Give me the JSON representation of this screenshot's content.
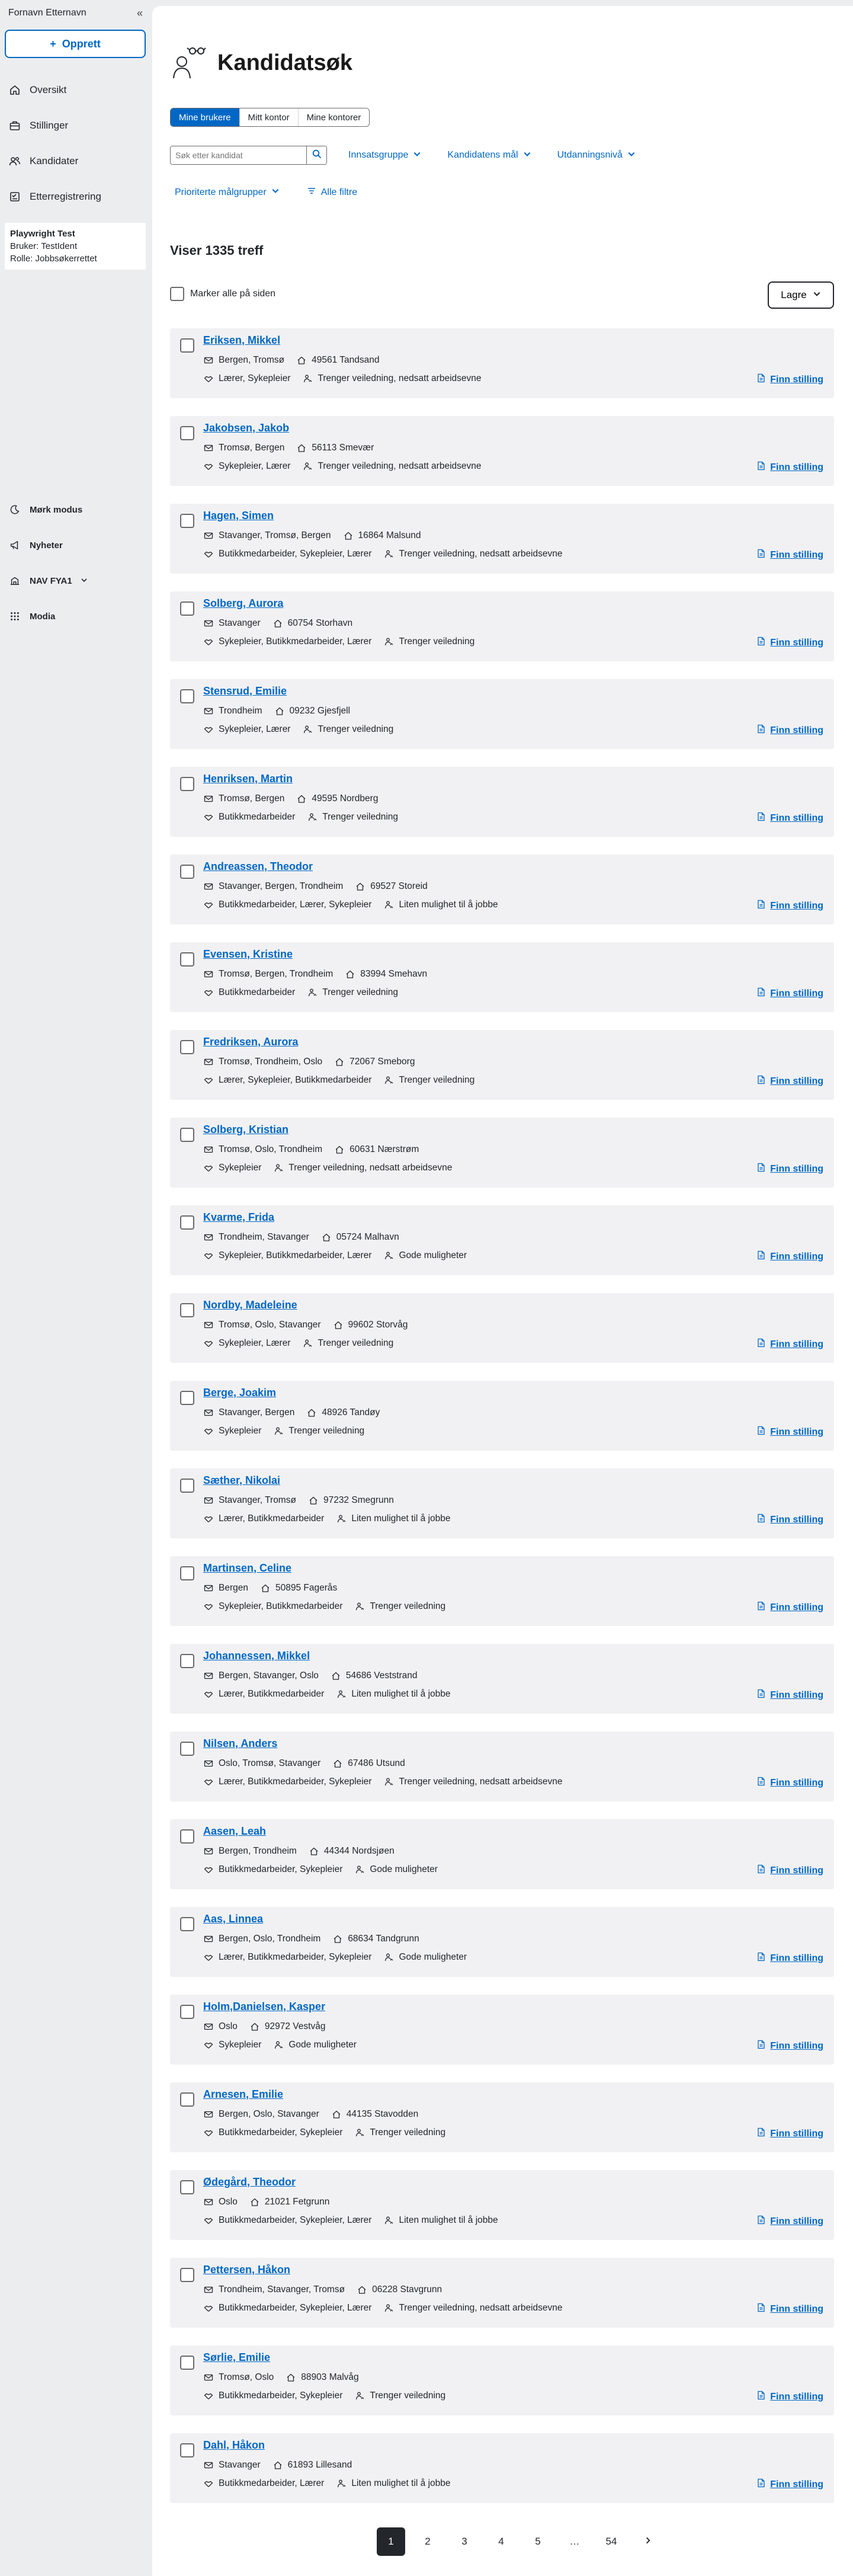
{
  "sidebar": {
    "user_name": "Fornavn Etternavn",
    "collapse_icon": "«",
    "create_button": "Opprett",
    "nav": [
      {
        "label": "Oversikt",
        "icon": "home-icon"
      },
      {
        "label": "Stillinger",
        "icon": "briefcase-icon"
      },
      {
        "label": "Kandidater",
        "icon": "people-icon"
      },
      {
        "label": "Etterregistrering",
        "icon": "checklist-icon"
      }
    ],
    "info": {
      "title": "Playwright Test",
      "user": "Bruker: TestIdent",
      "role": "Rolle: Jobbsøkerrettet"
    },
    "bottom": [
      {
        "label": "Mørk modus",
        "icon": "moon-icon"
      },
      {
        "label": "Nyheter",
        "icon": "megaphone-icon"
      },
      {
        "label": "NAV FYA1",
        "icon": "office-icon"
      },
      {
        "label": "Modia",
        "icon": "grid-icon"
      }
    ]
  },
  "header": {
    "title": "Kandidatsøk"
  },
  "tabs": [
    "Mine brukere",
    "Mitt kontor",
    "Mine kontorer"
  ],
  "active_tab": 0,
  "search": {
    "placeholder": "Søk etter kandidat",
    "value": ""
  },
  "filters": [
    "Innsatsgruppe",
    "Kandidatens mål",
    "Utdanningsnivå"
  ],
  "filters2": {
    "priority": "Prioriterte målgrupper",
    "all": "Alle filtre"
  },
  "result_count": "Viser 1335 treff",
  "select_all_label": "Marker alle på siden",
  "save_button": "Lagre",
  "finn_stilling_label": "Finn stilling",
  "candidates": [
    {
      "name": "Eriksen, Mikkel",
      "locations": "Bergen, Tromsø",
      "address": "49561 Tandsand",
      "jobs": "Lærer, Sykepleier",
      "need": "Trenger veiledning, nedsatt arbeidsevne"
    },
    {
      "name": "Jakobsen, Jakob",
      "locations": "Tromsø, Bergen",
      "address": "56113 Smevær",
      "jobs": "Sykepleier, Lærer",
      "need": "Trenger veiledning, nedsatt arbeidsevne"
    },
    {
      "name": "Hagen, Simen",
      "locations": "Stavanger, Tromsø, Bergen",
      "address": "16864 Malsund",
      "jobs": "Butikkmedarbeider, Sykepleier, Lærer",
      "need": "Trenger veiledning, nedsatt arbeidsevne"
    },
    {
      "name": "Solberg, Aurora",
      "locations": "Stavanger",
      "address": "60754 Storhavn",
      "jobs": "Sykepleier, Butikkmedarbeider, Lærer",
      "need": "Trenger veiledning"
    },
    {
      "name": "Stensrud, Emilie",
      "locations": "Trondheim",
      "address": "09232 Gjesfjell",
      "jobs": "Sykepleier, Lærer",
      "need": "Trenger veiledning"
    },
    {
      "name": "Henriksen, Martin",
      "locations": "Tromsø, Bergen",
      "address": "49595 Nordberg",
      "jobs": "Butikkmedarbeider",
      "need": "Trenger veiledning"
    },
    {
      "name": "Andreassen, Theodor",
      "locations": "Stavanger, Bergen, Trondheim",
      "address": "69527 Storeid",
      "jobs": "Butikkmedarbeider, Lærer, Sykepleier",
      "need": "Liten mulighet til å jobbe"
    },
    {
      "name": "Evensen, Kristine",
      "locations": "Tromsø, Bergen, Trondheim",
      "address": "83994 Smehavn",
      "jobs": "Butikkmedarbeider",
      "need": "Trenger veiledning"
    },
    {
      "name": "Fredriksen, Aurora",
      "locations": "Tromsø, Trondheim, Oslo",
      "address": "72067 Smeborg",
      "jobs": "Lærer, Sykepleier, Butikkmedarbeider",
      "need": "Trenger veiledning"
    },
    {
      "name": "Solberg, Kristian",
      "locations": "Tromsø, Oslo, Trondheim",
      "address": "60631 Nærstrøm",
      "jobs": "Sykepleier",
      "need": "Trenger veiledning, nedsatt arbeidsevne"
    },
    {
      "name": "Kvarme, Frida",
      "locations": "Trondheim, Stavanger",
      "address": "05724 Malhavn",
      "jobs": "Sykepleier, Butikkmedarbeider, Lærer",
      "need": "Gode muligheter"
    },
    {
      "name": "Nordby, Madeleine",
      "locations": "Tromsø, Oslo, Stavanger",
      "address": "99602 Storvåg",
      "jobs": "Sykepleier, Lærer",
      "need": "Trenger veiledning"
    },
    {
      "name": "Berge, Joakim",
      "locations": "Stavanger, Bergen",
      "address": "48926 Tandøy",
      "jobs": "Sykepleier",
      "need": "Trenger veiledning"
    },
    {
      "name": "Sæther, Nikolai",
      "locations": "Stavanger, Tromsø",
      "address": "97232 Smegrunn",
      "jobs": "Lærer, Butikkmedarbeider",
      "need": "Liten mulighet til å jobbe"
    },
    {
      "name": "Martinsen, Celine",
      "locations": "Bergen",
      "address": "50895 Fagerås",
      "jobs": "Sykepleier, Butikkmedarbeider",
      "need": "Trenger veiledning"
    },
    {
      "name": "Johannessen, Mikkel",
      "locations": "Bergen, Stavanger, Oslo",
      "address": "54686 Veststrand",
      "jobs": "Lærer, Butikkmedarbeider",
      "need": "Liten mulighet til å jobbe"
    },
    {
      "name": "Nilsen, Anders",
      "locations": "Oslo, Tromsø, Stavanger",
      "address": "67486 Utsund",
      "jobs": "Lærer, Butikkmedarbeider, Sykepleier",
      "need": "Trenger veiledning, nedsatt arbeidsevne"
    },
    {
      "name": "Aasen, Leah",
      "locations": "Bergen, Trondheim",
      "address": "44344 Nordsjøen",
      "jobs": "Butikkmedarbeider, Sykepleier",
      "need": "Gode muligheter"
    },
    {
      "name": "Aas, Linnea",
      "locations": "Bergen, Oslo, Trondheim",
      "address": "68634 Tandgrunn",
      "jobs": "Lærer, Butikkmedarbeider, Sykepleier",
      "need": "Gode muligheter"
    },
    {
      "name": "Holm,Danielsen, Kasper",
      "locations": "Oslo",
      "address": "92972 Vestvåg",
      "jobs": "Sykepleier",
      "need": "Gode muligheter"
    },
    {
      "name": "Arnesen, Emilie",
      "locations": "Bergen, Oslo, Stavanger",
      "address": "44135 Stavodden",
      "jobs": "Butikkmedarbeider, Sykepleier",
      "need": "Trenger veiledning"
    },
    {
      "name": "Ødegård, Theodor",
      "locations": "Oslo",
      "address": "21021 Fetgrunn",
      "jobs": "Butikkmedarbeider, Sykepleier, Lærer",
      "need": "Liten mulighet til å jobbe"
    },
    {
      "name": "Pettersen, Håkon",
      "locations": "Trondheim, Stavanger, Tromsø",
      "address": "06228 Stavgrunn",
      "jobs": "Butikkmedarbeider, Sykepleier, Lærer",
      "need": "Trenger veiledning, nedsatt arbeidsevne"
    },
    {
      "name": "Sørlie, Emilie",
      "locations": "Tromsø, Oslo",
      "address": "88903 Malvåg",
      "jobs": "Butikkmedarbeider, Sykepleier",
      "need": "Trenger veiledning"
    },
    {
      "name": "Dahl, Håkon",
      "locations": "Stavanger",
      "address": "61893 Lillesand",
      "jobs": "Butikkmedarbeider, Lærer",
      "need": "Liten mulighet til å jobbe"
    }
  ],
  "pagination": {
    "pages": [
      "1",
      "2",
      "3",
      "4",
      "5",
      "…",
      "54"
    ],
    "current": "1",
    "next_icon": "chevron-right-icon"
  },
  "colors": {
    "accent": "#0067c5",
    "card_bg": "#f1f1f3",
    "sidebar_bg": "#ecedef"
  }
}
